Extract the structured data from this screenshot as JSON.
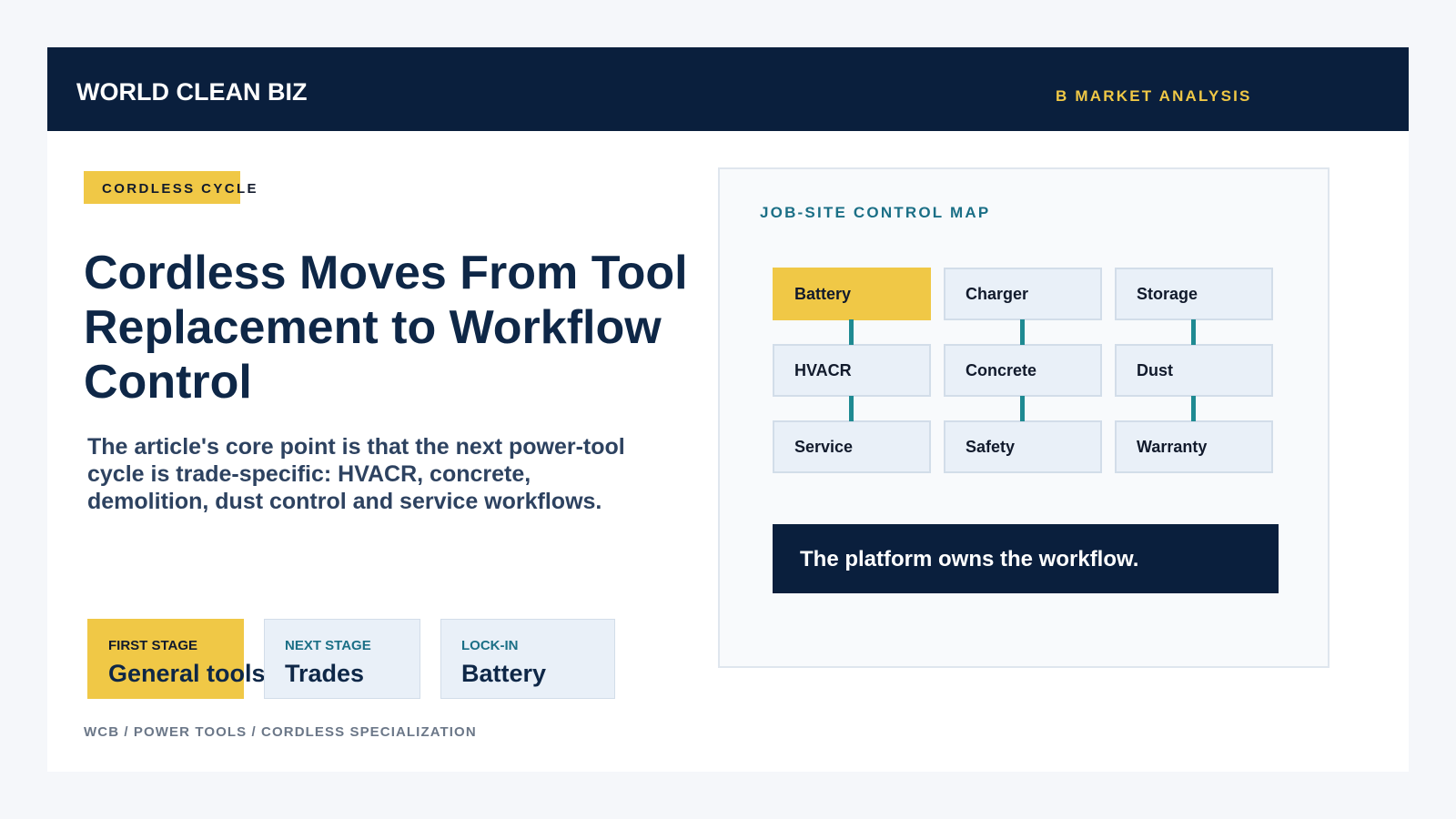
{
  "header": {
    "brand": "WORLD CLEAN BIZ",
    "section": "B MARKET ANALYSIS"
  },
  "kicker": "CORDLESS CYCLE",
  "headline": "Cordless Moves From Tool Replacement to Workflow Control",
  "lede": "The article's core point is that the next power-tool cycle is trade-specific: HVACR, concrete, demolition, dust control and service workflows.",
  "stages": [
    {
      "label": "FIRST STAGE",
      "value": "General tools"
    },
    {
      "label": "NEXT STAGE",
      "value": "Trades"
    },
    {
      "label": "LOCK-IN",
      "value": "Battery"
    }
  ],
  "footer": "WCB / POWER TOOLS / CORDLESS SPECIALIZATION",
  "map": {
    "title": "JOB-SITE CONTROL MAP",
    "nodes": [
      "Battery",
      "Charger",
      "Storage",
      "HVACR",
      "Concrete",
      "Dust",
      "Service",
      "Safety",
      "Warranty"
    ],
    "callout": "The platform owns the workflow."
  },
  "colors": {
    "navy": "#0a1f3d",
    "accent_yellow": "#f0c846",
    "teal": "#1f8a92",
    "panel_blue": "#e9f0f8"
  }
}
